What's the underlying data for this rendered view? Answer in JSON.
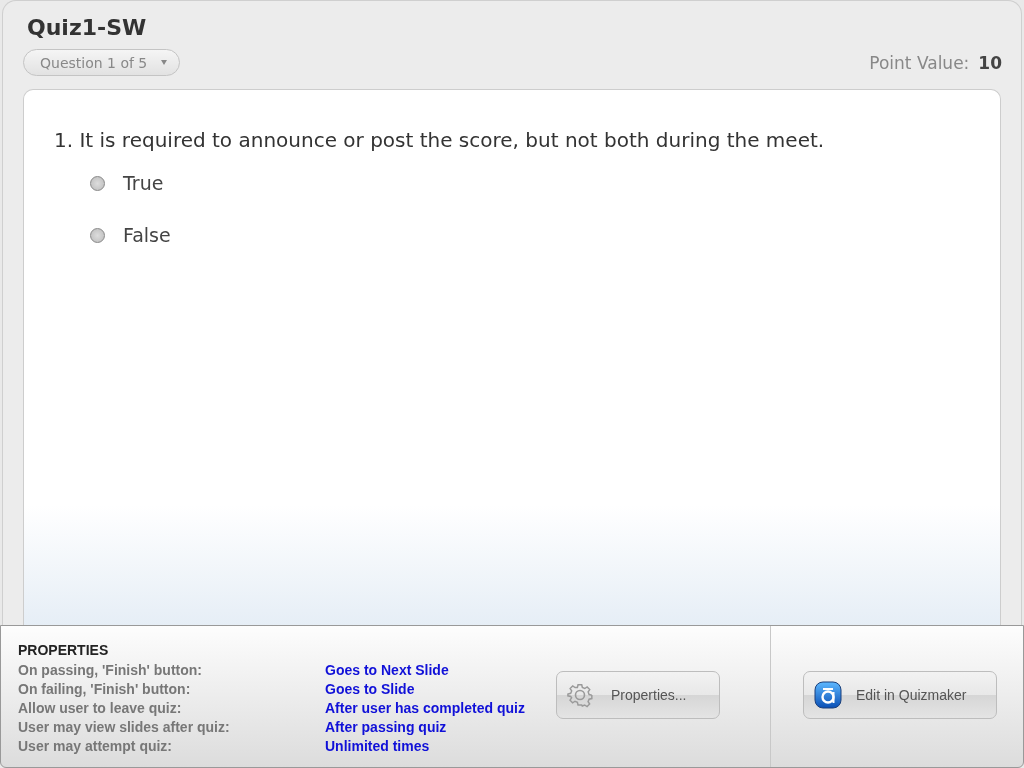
{
  "quiz": {
    "title": "Quiz1-SW",
    "question_selector": "Question 1 of 5",
    "point_value_label": "Point Value:",
    "point_value": "10"
  },
  "question": {
    "text": "1. It is required to announce or post the score, but not both during the meet.",
    "options": [
      {
        "label": "True",
        "selected": false
      },
      {
        "label": "False",
        "selected": false
      }
    ]
  },
  "properties": {
    "heading": "PROPERTIES",
    "rows": [
      {
        "label": "On passing, 'Finish' button:",
        "value": "Goes to Next Slide"
      },
      {
        "label": "On failing, 'Finish' button:",
        "value": "Goes to Slide"
      },
      {
        "label": "Allow user to leave quiz:",
        "value": "After user has completed quiz"
      },
      {
        "label": "User may view slides after quiz:",
        "value": "After passing quiz"
      },
      {
        "label": "User may attempt quiz:",
        "value": "Unlimited times"
      }
    ],
    "buttons": [
      {
        "kind": "properties",
        "label": "Properties..."
      },
      {
        "kind": "quizmaker",
        "label": "Edit in Quizmaker"
      }
    ]
  }
}
